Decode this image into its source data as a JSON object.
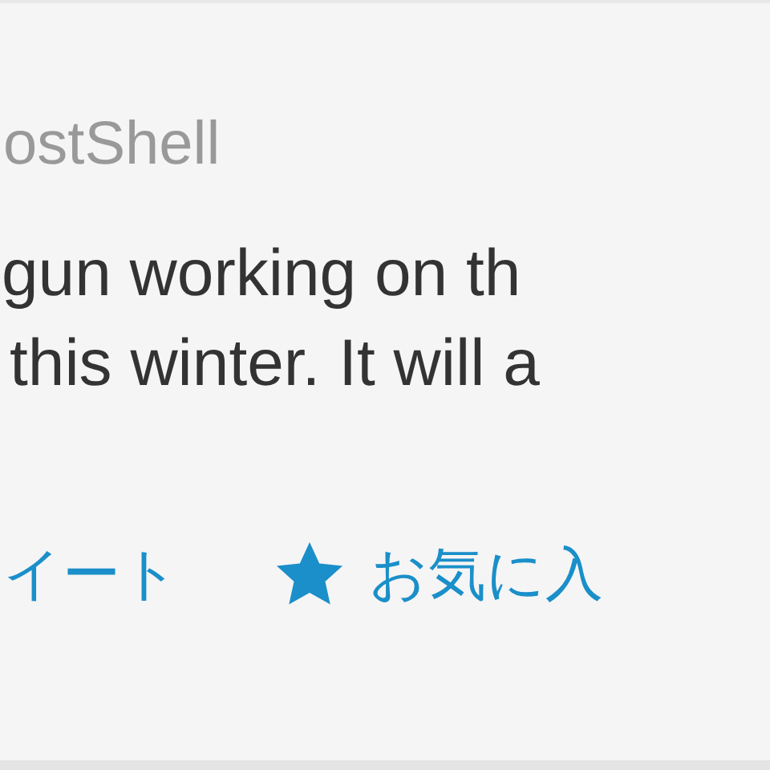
{
  "tweet": {
    "username": "ostShell",
    "text_lines": [
      "gun working on th",
      "this winter. It will a"
    ],
    "actions": [
      {
        "kind": "retweet",
        "label": "イート"
      },
      {
        "kind": "favorite",
        "label": "お気に入"
      }
    ]
  }
}
